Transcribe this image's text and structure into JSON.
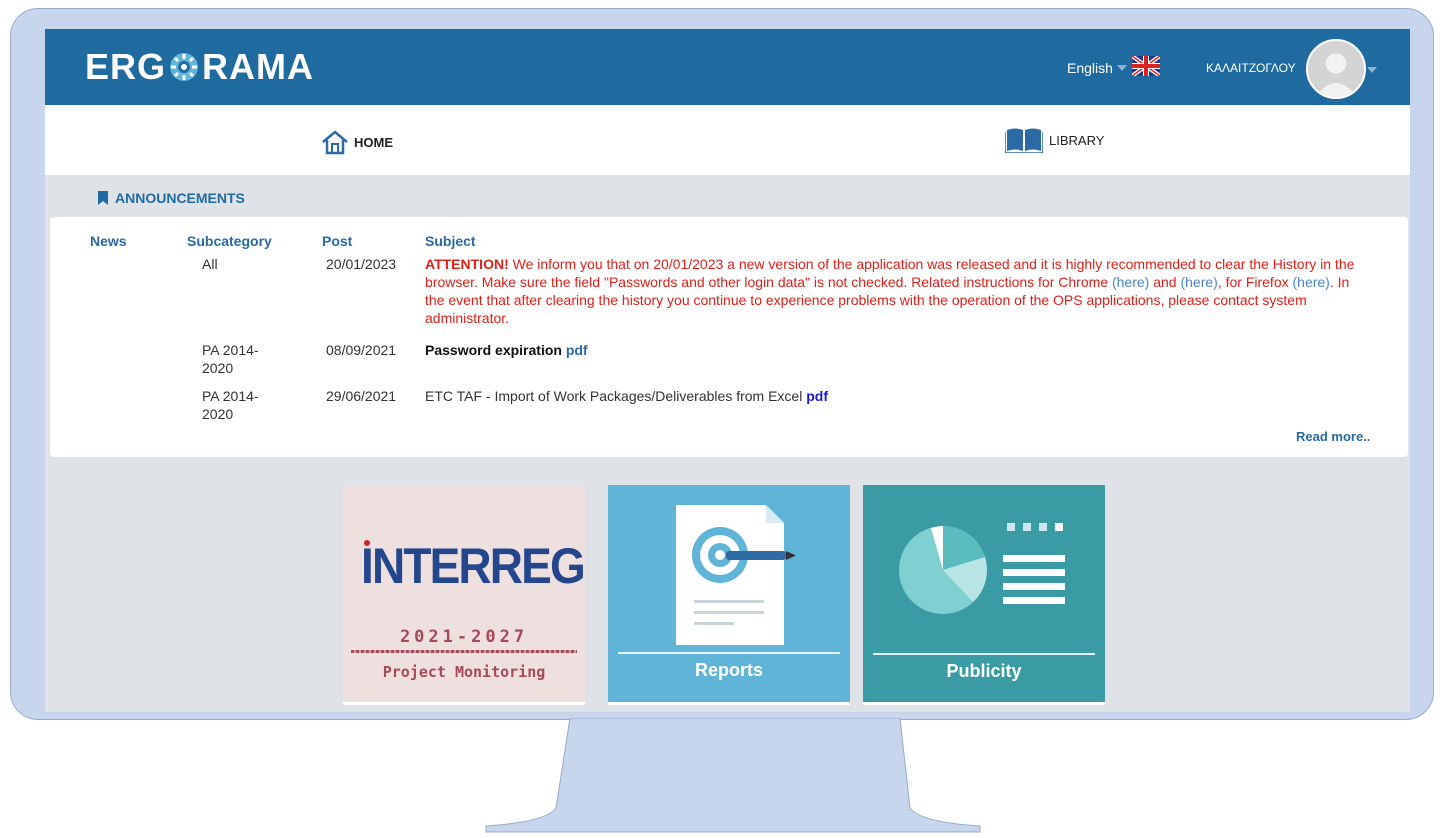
{
  "header": {
    "logo_left": "ERG",
    "logo_right": "RAMA",
    "language": "English",
    "user_name": "ΚΑΛΑΙΤΖΟΓΛΟΥ"
  },
  "nav": {
    "home": "HOME",
    "library": "LIBRARY"
  },
  "announcements": {
    "title": "ANNOUNCEMENTS",
    "columns": {
      "news": "News",
      "subcategory": "Subcategory",
      "post": "Post",
      "subject": "Subject"
    },
    "rows": [
      {
        "subcategory": "All",
        "post": "20/01/2023",
        "attention": "ATTENTION!",
        "text_1": " We inform you that on 20/01/2023 a new version of the application was released and it is highly recommended to clear the History in the browser. Make sure the field \"Passwords and other login data\" is not checked. Related instructions for Chrome ",
        "link_1": "(here)",
        "text_2": " and ",
        "link_2": "(here)",
        "text_3": ", for Firefox ",
        "link_3": "(here)",
        "text_4": ". In the event that after clearing the history you continue to experience problems with the operation of the OPS applications, please contact system administrator."
      },
      {
        "subcategory_1": "PA 2014-",
        "subcategory_2": "2020",
        "post": "08/09/2021",
        "subject": "Password expiration",
        "link": "pdf"
      },
      {
        "subcategory_1": "PA 2014-",
        "subcategory_2": "2020",
        "post": "29/06/2021",
        "subject": "ETC TAF - Import of Work Packages/Deliverables from Excel",
        "link": "pdf"
      }
    ],
    "read_more": "Read more.."
  },
  "tiles": {
    "interreg_logo": "INTERREG",
    "interreg_years": "2021-2027",
    "interreg_caption": "Project Monitoring",
    "reports": "Reports",
    "publicity": "Publicity"
  },
  "colors": {
    "topbar": "#1f6b9f",
    "warning": "#e0201c",
    "link": "#2b6aa5",
    "frame": "#c7d6ec"
  }
}
